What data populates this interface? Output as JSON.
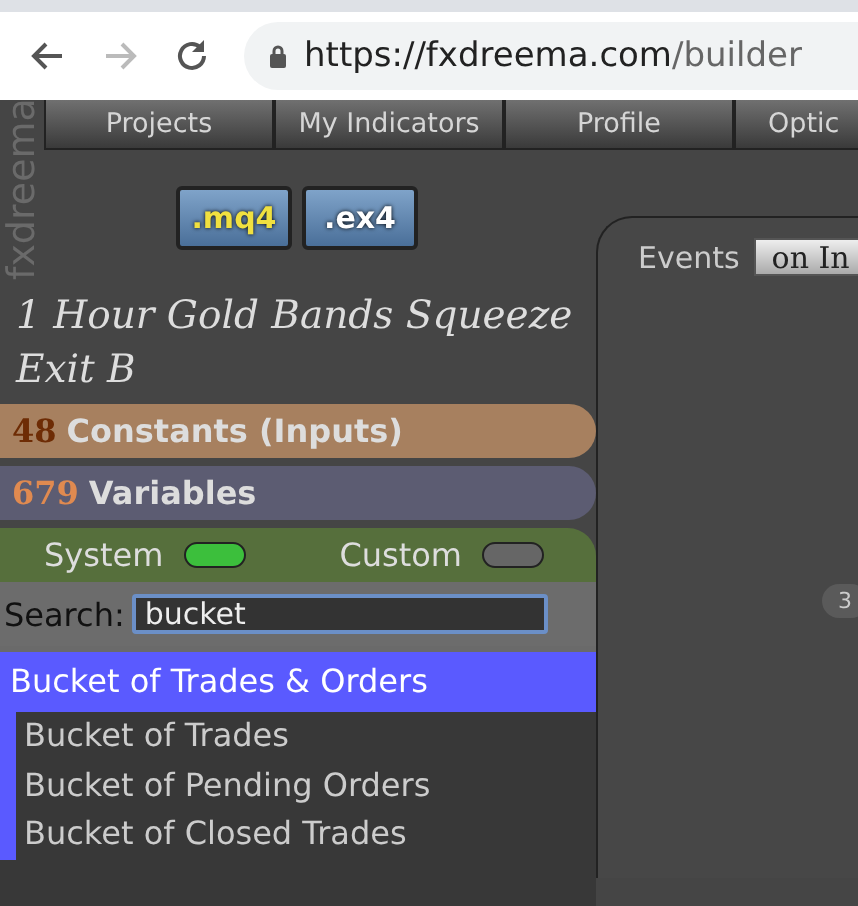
{
  "browser": {
    "url_host": "https://fxdreema.com",
    "url_path": "/builder"
  },
  "logo": "fxdreema",
  "nav_tabs": [
    {
      "label": "Projects"
    },
    {
      "label": "My Indicators"
    },
    {
      "label": "Profile"
    },
    {
      "label": "Optic"
    }
  ],
  "export_buttons": [
    {
      "label": ".mq4",
      "kind": "mq4"
    },
    {
      "label": ".ex4",
      "kind": "ex4"
    }
  ],
  "project_title": "1 Hour Gold Bands Squeeze Exit B",
  "sections": [
    {
      "count": "48",
      "label": "Constants (Inputs)",
      "color": "#a7805f"
    },
    {
      "count": "679",
      "label": "Variables",
      "color": "#5c5c72"
    }
  ],
  "toggles": [
    {
      "label": "System",
      "on": true
    },
    {
      "label": "Custom",
      "on": false
    }
  ],
  "search": {
    "label": "Search:",
    "value": "bucket"
  },
  "results": [
    {
      "label": "Bucket of Trades & Orders",
      "selected": true,
      "children": [
        {
          "label": "Bucket of Trades",
          "selected": false
        },
        {
          "label": "Bucket of Pending Orders",
          "selected": false
        },
        {
          "label": "Bucket of Closed Trades",
          "selected": false
        }
      ]
    }
  ],
  "events": {
    "label": "Events",
    "tab": "on In"
  },
  "badge": "3"
}
